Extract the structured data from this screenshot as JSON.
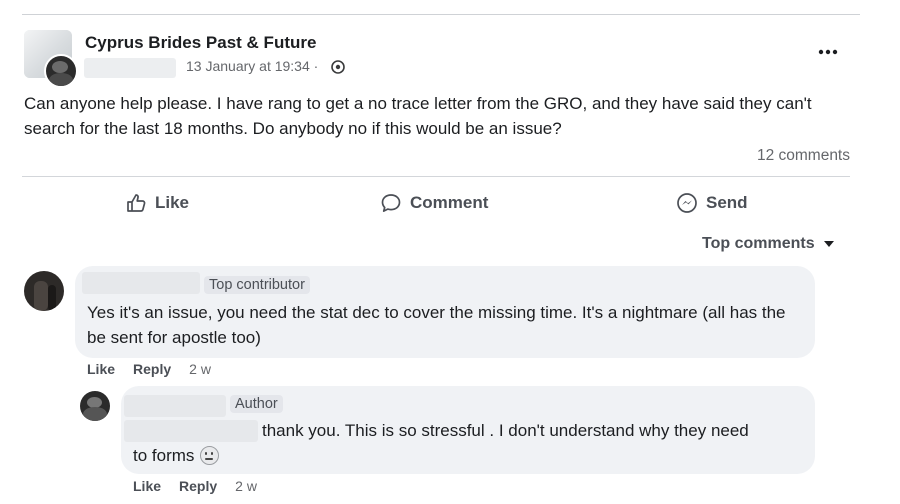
{
  "post": {
    "group_name": "Cyprus Brides Past & Future",
    "timestamp": "13 January at 19:34 ·",
    "privacy_icon": "globe-icon",
    "body": "Can anyone help please. I have rang to get a no trace letter from the GRO, and they have said they can't search for the last 18 months. Do anybody no if this would be an issue?",
    "comments_count": "12 comments"
  },
  "actions": {
    "like_label": "Like",
    "comment_label": "Comment",
    "send_label": "Send"
  },
  "sort": {
    "label": "Top comments"
  },
  "comments": [
    {
      "badge": "Top contributor",
      "text": "Yes it's an issue, you need the stat dec to cover the missing time. It's a nightmare (all has the be sent for apostle too)",
      "like_label": "Like",
      "reply_label": "Reply",
      "age": "2 w"
    },
    {
      "badge": "Author",
      "text_line1": "thank you. This is so stressful . I don't understand why they need",
      "text_line2": "to forms",
      "emoji_icon": "sad-face-emoji-icon",
      "like_label": "Like",
      "reply_label": "Reply",
      "age": "2 w"
    }
  ],
  "colors": {
    "text_primary": "#1c1e21",
    "text_secondary": "#65676b",
    "bubble_bg": "#f0f2f5"
  }
}
